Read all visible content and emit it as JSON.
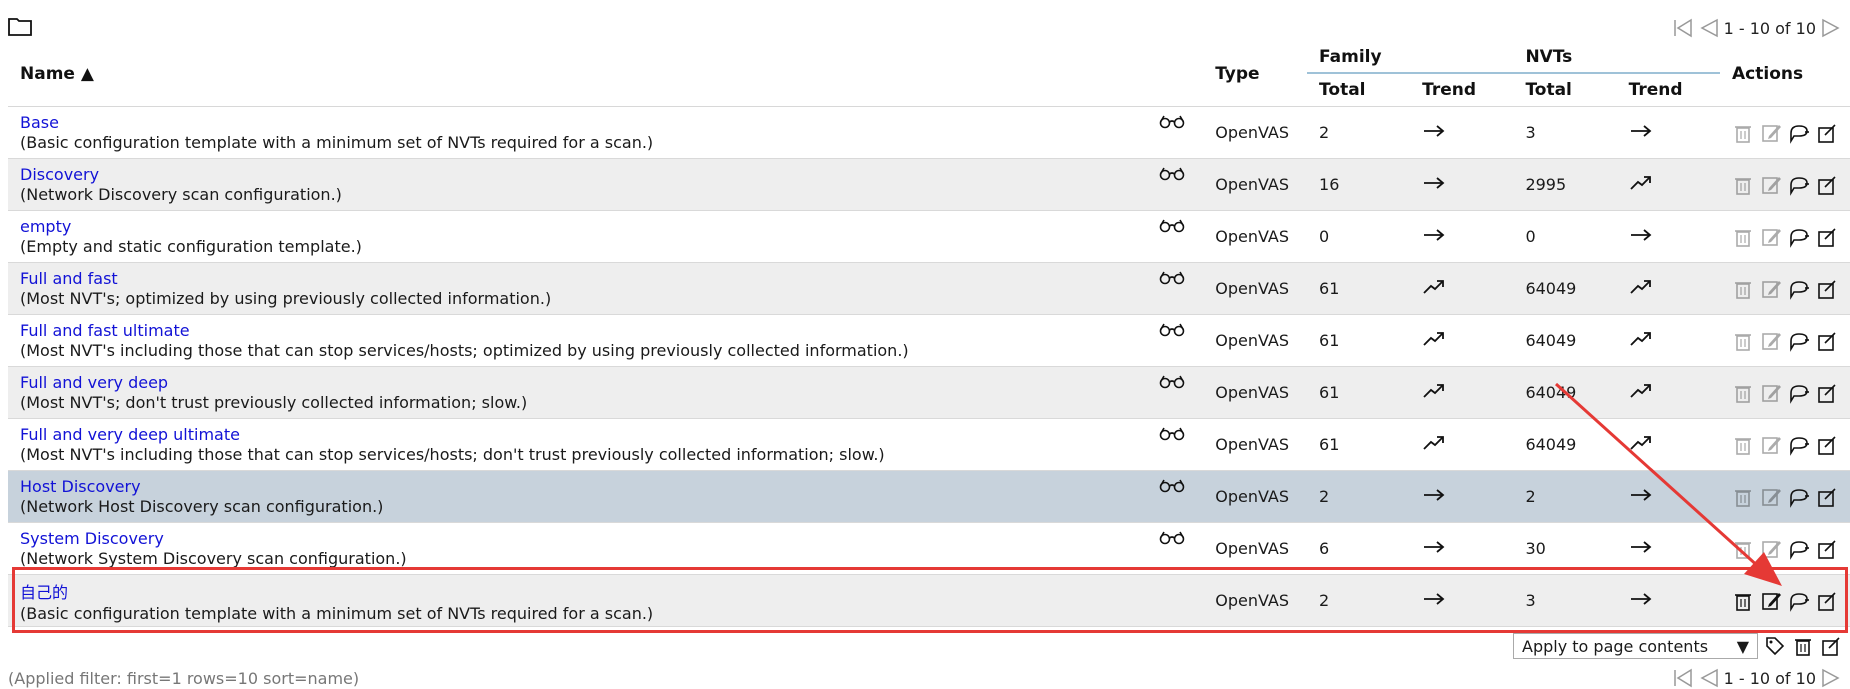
{
  "pager": {
    "range": "1 - 10 of 10"
  },
  "filter": {
    "text": "(Applied filter: first=1 rows=10 sort=name)"
  },
  "headers": {
    "name": "Name ▲",
    "type": "Type",
    "family": "Family",
    "nvts": "NVTs",
    "actions": "Actions",
    "total": "Total",
    "trend": "Trend"
  },
  "rows": [
    {
      "name": "Base",
      "desc": "(Basic configuration template with a minimum set of NVTs required for a scan.)",
      "type": "OpenVAS",
      "family_total": "2",
      "family_trend": "flat",
      "nvt_total": "3",
      "nvt_trend": "flat"
    },
    {
      "name": "Discovery",
      "desc": "(Network Discovery scan configuration.)",
      "type": "OpenVAS",
      "family_total": "16",
      "family_trend": "flat",
      "nvt_total": "2995",
      "nvt_trend": "up"
    },
    {
      "name": "empty",
      "desc": "(Empty and static configuration template.)",
      "type": "OpenVAS",
      "family_total": "0",
      "family_trend": "flat",
      "nvt_total": "0",
      "nvt_trend": "flat"
    },
    {
      "name": "Full and fast",
      "desc": "(Most NVT's; optimized by using previously collected information.)",
      "type": "OpenVAS",
      "family_total": "61",
      "family_trend": "up",
      "nvt_total": "64049",
      "nvt_trend": "up"
    },
    {
      "name": "Full and fast ultimate",
      "desc": "(Most NVT's including those that can stop services/hosts; optimized by using previously collected information.)",
      "type": "OpenVAS",
      "family_total": "61",
      "family_trend": "up",
      "nvt_total": "64049",
      "nvt_trend": "up"
    },
    {
      "name": "Full and very deep",
      "desc": "(Most NVT's; don't trust previously collected information; slow.)",
      "type": "OpenVAS",
      "family_total": "61",
      "family_trend": "up",
      "nvt_total": "64049",
      "nvt_trend": "up"
    },
    {
      "name": "Full and very deep ultimate",
      "desc": "(Most NVT's including those that can stop services/hosts; don't trust previously collected information; slow.)",
      "type": "OpenVAS",
      "family_total": "61",
      "family_trend": "up",
      "nvt_total": "64049",
      "nvt_trend": "up"
    },
    {
      "name": "Host Discovery",
      "desc": "(Network Host Discovery scan configuration.)",
      "type": "OpenVAS",
      "family_total": "2",
      "family_trend": "flat",
      "nvt_total": "2",
      "nvt_trend": "flat"
    },
    {
      "name": "System Discovery",
      "desc": "(Network System Discovery scan configuration.)",
      "type": "OpenVAS",
      "family_total": "6",
      "family_trend": "flat",
      "nvt_total": "30",
      "nvt_trend": "flat"
    },
    {
      "name": "自己的",
      "desc": "(Basic configuration template with a minimum set of NVTs required for a scan.)",
      "type": "OpenVAS",
      "family_total": "2",
      "family_trend": "flat",
      "nvt_total": "3",
      "nvt_trend": "flat"
    }
  ],
  "bulk": {
    "select_value": "Apply to page contents",
    "select_caret": "▼"
  },
  "colors": {
    "link": "#1212d6",
    "highlight_row": "#c7d2dc",
    "alt_row": "#eeeeee",
    "annotation": "#e53935",
    "header_rule": "#9fc2d8"
  }
}
